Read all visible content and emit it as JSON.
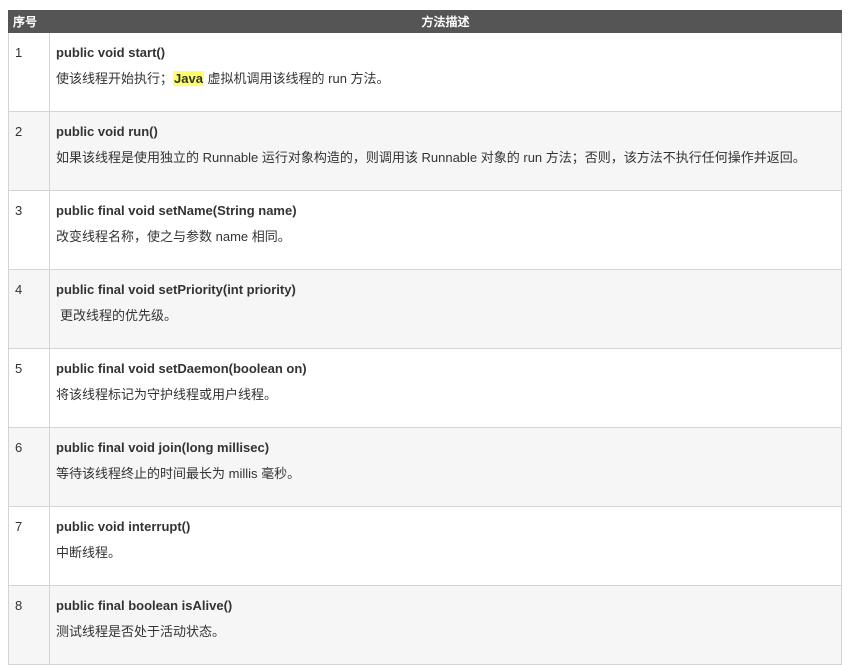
{
  "header": {
    "num": "序号",
    "desc": "方法描述"
  },
  "rows": [
    {
      "num": "1",
      "sig": "public void start()",
      "pre": "使该线程开始执行；",
      "highlight": "Java",
      "post": " 虚拟机调用该线程的 run 方法。"
    },
    {
      "num": "2",
      "sig": "public void run()",
      "text": "如果该线程是使用独立的 Runnable 运行对象构造的，则调用该 Runnable 对象的 run 方法；否则，该方法不执行任何操作并返回。"
    },
    {
      "num": "3",
      "sig": "public final void setName(String name)",
      "text": "改变线程名称，使之与参数 name 相同。"
    },
    {
      "num": "4",
      "sig": "public final void setPriority(int priority)",
      "text": "更改线程的优先级。"
    },
    {
      "num": "5",
      "sig": "public final void setDaemon(boolean on)",
      "text": "将该线程标记为守护线程或用户线程。"
    },
    {
      "num": "6",
      "sig": "public final void join(long millisec)",
      "text": "等待该线程终止的时间最长为 millis 毫秒。"
    },
    {
      "num": "7",
      "sig": "public void interrupt()",
      "text": "中断线程。"
    },
    {
      "num": "8",
      "sig": "public final boolean isAlive()",
      "text": "测试线程是否处于活动状态。"
    }
  ]
}
